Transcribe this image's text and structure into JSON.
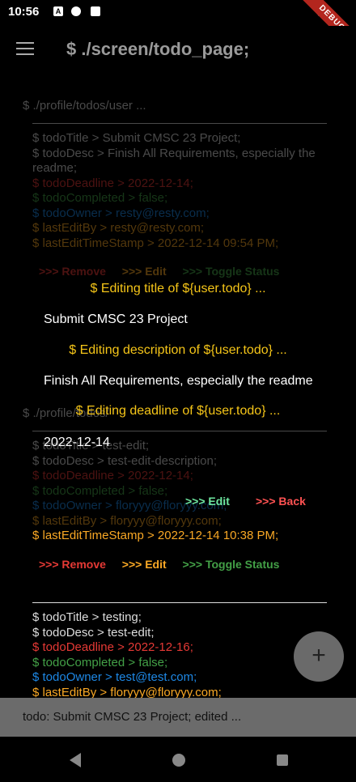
{
  "status_bar": {
    "time": "10:56",
    "debug_label": "DEBUG"
  },
  "app_bar": {
    "title": "$ ./screen/todo_page;"
  },
  "list": {
    "section1_title": "$ ./profile/todos/user ...",
    "section2_title": "$ ./profile/todos/",
    "todo1": {
      "title": "$ todoTitle > Submit CMSC 23 Project;",
      "desc": "$ todoDesc > Finish All Requirements, especially the readme;",
      "deadline": "$ todoDeadline > 2022-12-14;",
      "completed": "$ todoCompleted > false;",
      "owner": "$ todoOwner > resty@resty.com;",
      "last_edit_by": "$ lastEditBy > resty@resty.com;",
      "last_edit_time": "$ lastEditTimeStamp > 2022-12-14 09:54 PM;"
    },
    "todo2": {
      "title": "$ todoTitle > test-edit;",
      "desc": "$ todoDesc > test-edit-description;",
      "deadline": "$ todoDeadline > 2022-12-14;",
      "completed": "$ todoCompleted > false;",
      "owner": "$ todoOwner > floryyy@floryyy.com;",
      "last_edit_by": "$ lastEditBy > floryyy@floryyy.com;",
      "last_edit_time": "$ lastEditTimeStamp > 2022-12-14 10:38 PM;"
    },
    "todo3": {
      "title": "$ todoTitle > testing;",
      "desc": "$ todoDesc > test-edit;",
      "deadline": "$ todoDeadline > 2022-12-16;",
      "completed": "$ todoCompleted > false;",
      "owner": "$ todoOwner > test@test.com;",
      "last_edit_by": "$ lastEditBy > floryyy@floryyy.com;"
    },
    "actions": {
      "remove": ">>> Remove",
      "edit": ">>> Edit",
      "toggle": ">>> Toggle Status"
    }
  },
  "dialog": {
    "title_label": "$ Editing title of ${user.todo} ...",
    "title_value": "Submit CMSC 23 Project",
    "desc_label": "$ Editing description of ${user.todo} ...",
    "desc_value": "Finish All Requirements, especially the readme",
    "deadline_label": "$ Editing deadline of ${user.todo} ...",
    "deadline_value": "2022-12-14",
    "edit_button": ">>>  Edit",
    "back_button": ">>> Back"
  },
  "fab": {
    "label": "+"
  },
  "snackbar": {
    "message": "todo: Submit CMSC 23 Project; edited ..."
  },
  "colors": {
    "accent_yellow": "#f5c518",
    "red": "#e53935",
    "green": "#43a047",
    "blue": "#1e88e5",
    "orange": "#f9a825"
  }
}
